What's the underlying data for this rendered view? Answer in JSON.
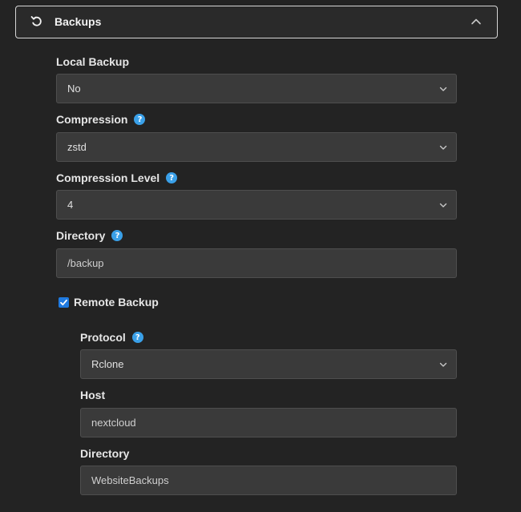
{
  "section": {
    "title": "Backups",
    "icon": "undo-icon",
    "toggle_icon": "chevron-up-icon"
  },
  "local_backup": {
    "label": "Local Backup",
    "value": "No"
  },
  "compression": {
    "label": "Compression",
    "value": "zstd"
  },
  "compression_level": {
    "label": "Compression Level",
    "value": "4"
  },
  "directory": {
    "label": "Directory",
    "placeholder": "/backup"
  },
  "remote_backup": {
    "label": "Remote Backup",
    "checked": true,
    "protocol": {
      "label": "Protocol",
      "value": "Rclone"
    },
    "host": {
      "label": "Host",
      "value": "nextcloud"
    },
    "directory": {
      "label": "Directory",
      "value": "WebsiteBackups"
    }
  },
  "colors": {
    "accent": "#1f7ae0",
    "help": "#3aa0e8",
    "background": "#232323",
    "field": "#3a3a3a"
  }
}
